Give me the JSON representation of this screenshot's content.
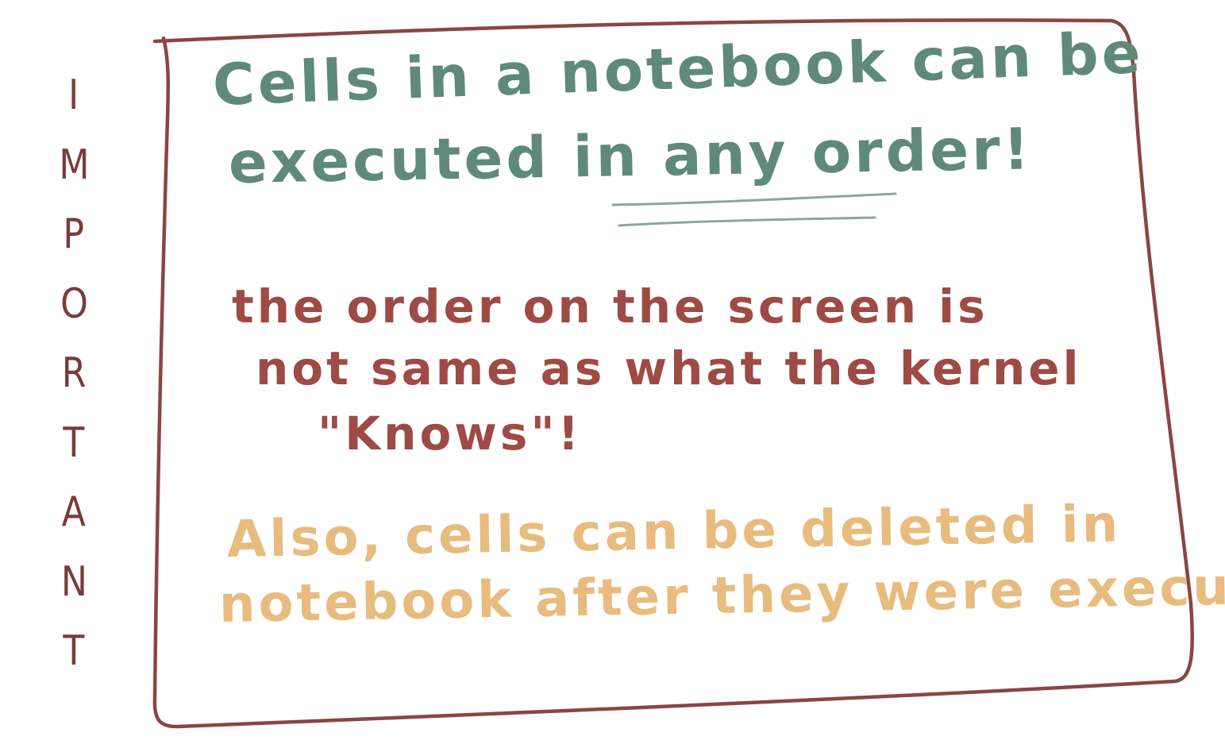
{
  "colors": {
    "frame": "#8a4545",
    "important": "#7a3b3b",
    "teal": "#5f8a7a",
    "teal_underline": "#8aa898",
    "red": "#9e4a45",
    "gold": "#e8bc7e"
  },
  "side_label": {
    "letters": [
      "I",
      "M",
      "P",
      "O",
      "R",
      "T",
      "A",
      "N",
      "T"
    ]
  },
  "note": {
    "main_line1": "Cells in a notebook can be",
    "main_line2_before": "executed in ",
    "main_line2_emphasis": "any order",
    "main_line2_after": "!",
    "detail_line1": "the order on the screen is",
    "detail_line2": "not same as what the kernel",
    "detail_line3": "\"Knows\"!",
    "extra_line1": "Also, cells can be deleted in",
    "extra_line2": "notebook after they were executed"
  }
}
